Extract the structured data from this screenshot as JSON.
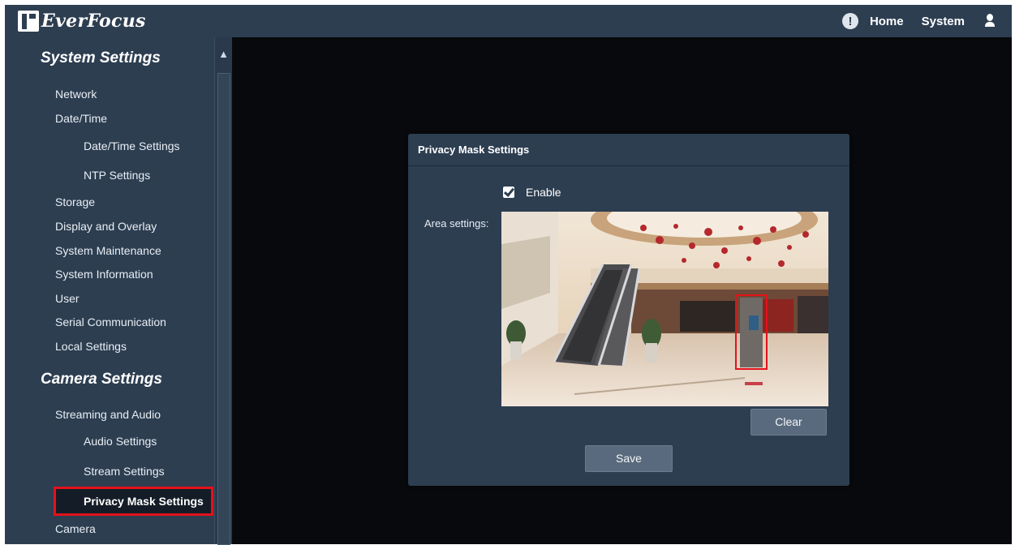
{
  "brand": {
    "name": "EverFocus"
  },
  "topnav": {
    "home": "Home",
    "system": "System"
  },
  "sidebar": {
    "system_title": "System Settings",
    "system_items": [
      {
        "label": "Network"
      },
      {
        "label": "Date/Time"
      },
      {
        "label": "Date/Time Settings"
      },
      {
        "label": "NTP Settings"
      },
      {
        "label": "Storage"
      },
      {
        "label": "Display and Overlay"
      },
      {
        "label": "System Maintenance"
      },
      {
        "label": "System Information"
      },
      {
        "label": "User"
      },
      {
        "label": "Serial Communication"
      },
      {
        "label": "Local Settings"
      }
    ],
    "camera_title": "Camera Settings",
    "camera_items": [
      {
        "label": "Streaming and Audio"
      },
      {
        "label": "Audio Settings"
      },
      {
        "label": "Stream Settings"
      },
      {
        "label": "Privacy Mask Settings"
      },
      {
        "label": "Camera"
      }
    ]
  },
  "dialog": {
    "title": "Privacy Mask Settings",
    "enable_label": "Enable",
    "enable_checked": true,
    "area_label": "Area settings:",
    "clear_label": "Clear",
    "save_label": "Save"
  },
  "colors": {
    "panel": "#2d3e51",
    "background": "#07090c",
    "highlight": "#e3121b",
    "button": "#5a6a7e"
  },
  "icons": [
    "alert-icon",
    "user-icon",
    "chevron-up-icon",
    "checkbox-check-icon"
  ]
}
